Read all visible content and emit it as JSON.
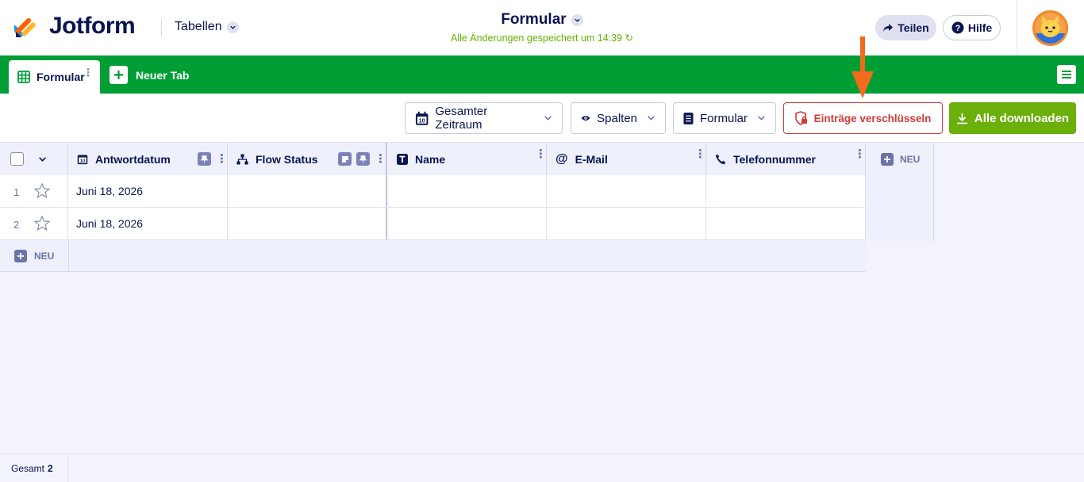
{
  "header": {
    "brand": "Jotform",
    "tables_label": "Tabellen",
    "form_title": "Formular",
    "save_status": "Alle Änderungen gespeichert um 14:39",
    "share_label": "Teilen",
    "help_label": "Hilfe"
  },
  "tabs": {
    "active_label": "Formular",
    "new_tab_label": "Neuer Tab"
  },
  "toolbar": {
    "date_filter_label": "Gesamter Zeitraum",
    "date_icon_text": "10",
    "columns_label": "Spalten",
    "form_label": "Formular",
    "encrypt_label": "Einträge verschlüsseln",
    "download_label": "Alle downloaden"
  },
  "table": {
    "columns": [
      {
        "label": "Antwortdatum",
        "icon": "calendar-icon"
      },
      {
        "label": "Flow Status",
        "icon": "flow-icon"
      },
      {
        "label": "Name",
        "icon": "text-icon"
      },
      {
        "label": "E-Mail",
        "icon": "at-icon"
      },
      {
        "label": "Telefonnummer",
        "icon": "phone-icon"
      }
    ],
    "new_column_label": "NEU",
    "rows": [
      {
        "num": "1",
        "antwortdatum": "Juni 18, 2026",
        "flow_status": "",
        "name": "",
        "email": "",
        "telefon": ""
      },
      {
        "num": "2",
        "antwortdatum": "Juni 18, 2026",
        "flow_status": "",
        "name": "",
        "email": "",
        "telefon": ""
      }
    ],
    "new_row_label": "NEU"
  },
  "footer": {
    "total_label": "Gesamt",
    "total_value": "2"
  },
  "colors": {
    "brand_green": "#019e35",
    "download_green": "#6aaf0a",
    "encrypt_red": "#d03a3a",
    "annotation_orange": "#f26a1b",
    "navy": "#0a1551"
  }
}
